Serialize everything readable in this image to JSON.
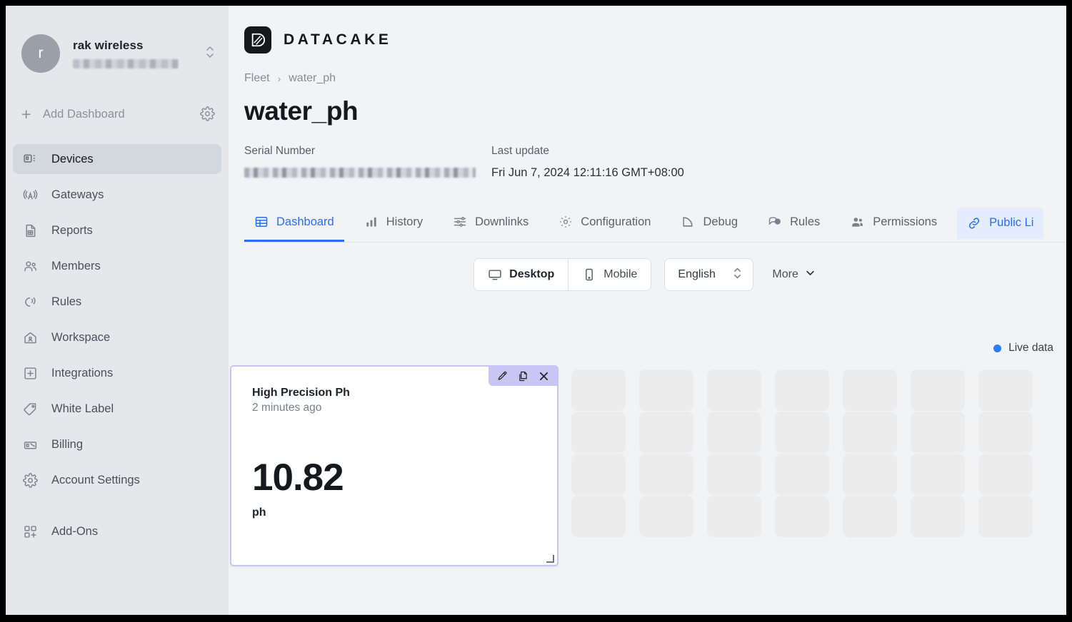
{
  "sidebar": {
    "account": {
      "avatar_initial": "r",
      "name": "rak wireless",
      "email_redacted": "",
      "switcher_icon": "chevron-up-down-icon"
    },
    "add_dashboard": {
      "label": "Add Dashboard",
      "plus_icon": "plus-icon",
      "settings_icon": "gear-icon"
    },
    "items": [
      {
        "label": "Devices",
        "icon": "devices-icon",
        "active": true
      },
      {
        "label": "Gateways",
        "icon": "antenna-icon",
        "active": false
      },
      {
        "label": "Reports",
        "icon": "document-icon",
        "active": false
      },
      {
        "label": "Members",
        "icon": "users-icon",
        "active": false
      },
      {
        "label": "Rules",
        "icon": "rules-bell-icon",
        "active": false
      },
      {
        "label": "Workspace",
        "icon": "home-icon",
        "active": false
      },
      {
        "label": "Integrations",
        "icon": "plus-square-icon",
        "active": false
      },
      {
        "label": "White Label",
        "icon": "tag-icon",
        "active": false
      },
      {
        "label": "Billing",
        "icon": "invoice-icon",
        "active": false
      },
      {
        "label": "Account Settings",
        "icon": "gear-icon",
        "active": false
      },
      {
        "label": "Add-Ons",
        "icon": "grid-plus-icon",
        "active": false
      }
    ]
  },
  "header": {
    "logo_text": "DATACAKE",
    "logo_icon": "datacake-logo-icon",
    "breadcrumb": {
      "root": "Fleet",
      "separator": "›",
      "current": "water_ph"
    },
    "page_title": "water_ph",
    "meta": {
      "serial_label": "Serial Number",
      "serial_value_redacted": "",
      "last_update_label": "Last update",
      "last_update_value": "Fri Jun 7, 2024 12:11:16 GMT+08:00"
    }
  },
  "tabs": [
    {
      "label": "Dashboard",
      "icon": "table-icon",
      "state": "active"
    },
    {
      "label": "History",
      "icon": "bar-chart-icon",
      "state": "normal"
    },
    {
      "label": "Downlinks",
      "icon": "sliders-icon",
      "state": "normal"
    },
    {
      "label": "Configuration",
      "icon": "gear-icon",
      "state": "normal"
    },
    {
      "label": "Debug",
      "icon": "signal-icon",
      "state": "normal"
    },
    {
      "label": "Rules",
      "icon": "chat-bubble-icon",
      "state": "normal"
    },
    {
      "label": "Permissions",
      "icon": "users-icon",
      "state": "normal"
    },
    {
      "label": "Public Li",
      "icon": "link-icon",
      "state": "highlighted"
    }
  ],
  "toolbar": {
    "view_modes": [
      {
        "label": "Desktop",
        "icon": "monitor-icon",
        "active": true
      },
      {
        "label": "Mobile",
        "icon": "smartphone-icon",
        "active": false
      }
    ],
    "language": {
      "value": "English",
      "icon": "chevron-up-down-icon"
    },
    "more": {
      "label": "More",
      "icon": "chevron-down-icon"
    }
  },
  "board": {
    "live_data": {
      "label": "Live data",
      "dot_color": "#2b7cf6"
    },
    "widget": {
      "title": "High Precision Ph",
      "subtitle": "2 minutes ago",
      "value": "10.82",
      "unit": "ph",
      "tools": [
        {
          "name": "edit-icon",
          "glyph": "pencil"
        },
        {
          "name": "duplicate-icon",
          "glyph": "copy"
        },
        {
          "name": "close-icon",
          "glyph": "x"
        }
      ],
      "border_color": "#c8c5f2",
      "toolbar_color": "#c9c6f3"
    },
    "grid": {
      "columns": 7,
      "rows": 4,
      "cell_color": "#ececed"
    }
  }
}
